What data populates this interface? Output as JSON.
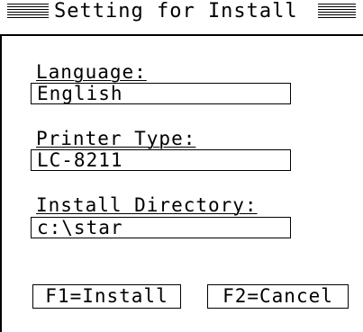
{
  "dialog": {
    "title": "Setting for Install",
    "language_label": "Language:",
    "language_value": "English",
    "printer_label": "Printer Type:",
    "printer_value": "LC-8211",
    "directory_label": "Install Directory:",
    "directory_value": "c:\\star",
    "install_button": "F1=Install",
    "cancel_button": "F2=Cancel"
  }
}
